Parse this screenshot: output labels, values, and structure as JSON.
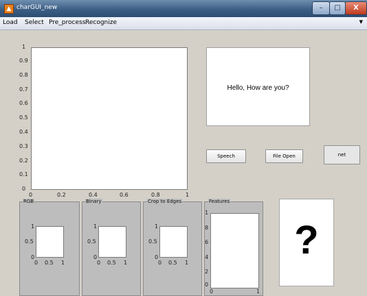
{
  "window": {
    "title": "charGUI_new",
    "app_icon_glyph": "▲",
    "minimize_glyph": "–",
    "maximize_glyph": "□",
    "close_glyph": "X"
  },
  "menu": {
    "items": [
      "Load",
      "Select",
      "Pre_process",
      "Recognize"
    ],
    "overflow_glyph": "▼"
  },
  "main_axes": {
    "y_ticks": [
      "1",
      "0.9",
      "0.8",
      "0.7",
      "0.6",
      "0.5",
      "0.4",
      "0.3",
      "0.2",
      "0.1",
      "0"
    ],
    "x_ticks": [
      "0",
      "0.2",
      "0.4",
      "0.6",
      "0.8",
      "1"
    ]
  },
  "greeting_box": {
    "text": "Hello, How are you?"
  },
  "buttons": {
    "speech": "Speech",
    "file_open": "File Open",
    "net": "net"
  },
  "panels": {
    "rgb": {
      "title": "RGB",
      "y_ticks": [
        "1",
        "0.5",
        "0"
      ],
      "x_ticks": [
        "0",
        "0.5",
        "1"
      ]
    },
    "binary": {
      "title": "Binary",
      "y_ticks": [
        "1",
        "0.5",
        "0"
      ],
      "x_ticks": [
        "0",
        "0.5",
        "1"
      ]
    },
    "crop": {
      "title": "Crop to Edges",
      "y_ticks": [
        "1",
        "0.5",
        "0"
      ],
      "x_ticks": [
        "0",
        "0.5",
        "1"
      ]
    },
    "features": {
      "title": "Features",
      "y_ticks": [
        "1",
        "8",
        "6",
        "4",
        "2",
        "0"
      ],
      "x_ticks": [
        "0",
        "1"
      ]
    }
  },
  "result": {
    "glyph": "?"
  },
  "colors": {
    "titlebar": "#3e5f85",
    "panel": "#bdbdbd",
    "figure_bg": "#d4d0c8",
    "close_button": "#c0391d"
  }
}
